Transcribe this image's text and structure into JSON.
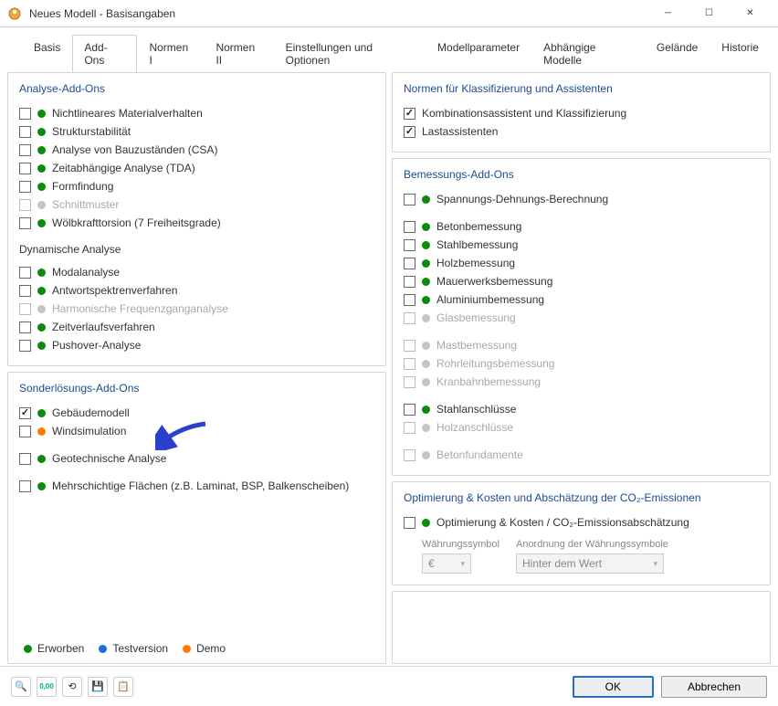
{
  "window": {
    "title": "Neues Modell - Basisangaben"
  },
  "tabs": [
    "Basis",
    "Add-Ons",
    "Normen I",
    "Normen II",
    "Einstellungen und Optionen",
    "Modellparameter",
    "Abhängige Modelle",
    "Gelände",
    "Historie"
  ],
  "analysis": {
    "title": "Analyse-Add-Ons",
    "items": [
      {
        "label": "Nichtlineares Materialverhalten",
        "dot": "green",
        "checked": false,
        "disabled": false
      },
      {
        "label": "Strukturstabilität",
        "dot": "green",
        "checked": false,
        "disabled": false
      },
      {
        "label": "Analyse von Bauzuständen (CSA)",
        "dot": "green",
        "checked": false,
        "disabled": false
      },
      {
        "label": "Zeitabhängige Analyse (TDA)",
        "dot": "green",
        "checked": false,
        "disabled": false
      },
      {
        "label": "Formfindung",
        "dot": "green",
        "checked": false,
        "disabled": false
      },
      {
        "label": "Schnittmuster",
        "dot": "grey",
        "checked": false,
        "disabled": true
      },
      {
        "label": "Wölbkrafttorsion (7 Freiheitsgrade)",
        "dot": "green",
        "checked": false,
        "disabled": false
      }
    ],
    "dyn_heading": "Dynamische Analyse",
    "dyn_items": [
      {
        "label": "Modalanalyse",
        "dot": "green",
        "checked": false,
        "disabled": false
      },
      {
        "label": "Antwortspektrenverfahren",
        "dot": "green",
        "checked": false,
        "disabled": false
      },
      {
        "label": "Harmonische Frequenzganganalyse",
        "dot": "grey",
        "checked": false,
        "disabled": true
      },
      {
        "label": "Zeitverlaufsverfahren",
        "dot": "green",
        "checked": false,
        "disabled": false
      },
      {
        "label": "Pushover-Analyse",
        "dot": "green",
        "checked": false,
        "disabled": false
      }
    ]
  },
  "special": {
    "title": "Sonderlösungs-Add-Ons",
    "items": [
      {
        "label": "Gebäudemodell",
        "dot": "green",
        "checked": true,
        "disabled": false
      },
      {
        "label": "Windsimulation",
        "dot": "orange",
        "checked": false,
        "disabled": false
      }
    ],
    "items2": [
      {
        "label": "Geotechnische Analyse",
        "dot": "green",
        "checked": false,
        "disabled": false
      }
    ],
    "items3": [
      {
        "label": "Mehrschichtige Flächen (z.B. Laminat, BSP, Balkenscheiben)",
        "dot": "green",
        "checked": false,
        "disabled": false
      }
    ]
  },
  "norms": {
    "title": "Normen für Klassifizierung und Assistenten",
    "items": [
      {
        "label": "Kombinationsassistent und Klassifizierung",
        "checked": true
      },
      {
        "label": "Lastassistenten",
        "checked": true
      }
    ]
  },
  "design": {
    "title": "Bemessungs-Add-Ons",
    "g1": [
      {
        "label": "Spannungs-Dehnungs-Berechnung",
        "dot": "green",
        "checked": false,
        "disabled": false
      }
    ],
    "g2": [
      {
        "label": "Betonbemessung",
        "dot": "green",
        "checked": false,
        "disabled": false
      },
      {
        "label": "Stahlbemessung",
        "dot": "green",
        "checked": false,
        "disabled": false
      },
      {
        "label": "Holzbemessung",
        "dot": "green",
        "checked": false,
        "disabled": false
      },
      {
        "label": "Mauerwerksbemessung",
        "dot": "green",
        "checked": false,
        "disabled": false
      },
      {
        "label": "Aluminiumbemessung",
        "dot": "green",
        "checked": false,
        "disabled": false
      },
      {
        "label": "Glasbemessung",
        "dot": "grey",
        "checked": false,
        "disabled": true
      }
    ],
    "g3": [
      {
        "label": "Mastbemessung",
        "dot": "grey",
        "checked": false,
        "disabled": true
      },
      {
        "label": "Rohrleitungsbemessung",
        "dot": "grey",
        "checked": false,
        "disabled": true
      },
      {
        "label": "Kranbahnbemessung",
        "dot": "grey",
        "checked": false,
        "disabled": true
      }
    ],
    "g4": [
      {
        "label": "Stahlanschlüsse",
        "dot": "green",
        "checked": false,
        "disabled": false
      },
      {
        "label": "Holzanschlüsse",
        "dot": "grey",
        "checked": false,
        "disabled": true
      }
    ],
    "g5": [
      {
        "label": "Betonfundamente",
        "dot": "grey",
        "checked": false,
        "disabled": true
      }
    ]
  },
  "opt": {
    "title": "Optimierung & Kosten und Abschätzung der CO₂-Emissionen",
    "item": {
      "label": "Optimierung & Kosten / CO₂-Emissionsabschätzung",
      "dot": "green",
      "checked": false
    },
    "currency_label": "Währungssymbol",
    "arrangement_label": "Anordnung der Währungssymbole",
    "currency_value": "€",
    "arrangement_value": "Hinter dem Wert"
  },
  "legend": {
    "purchased": "Erworben",
    "trial": "Testversion",
    "demo": "Demo"
  },
  "buttons": {
    "ok": "OK",
    "cancel": "Abbrechen"
  }
}
